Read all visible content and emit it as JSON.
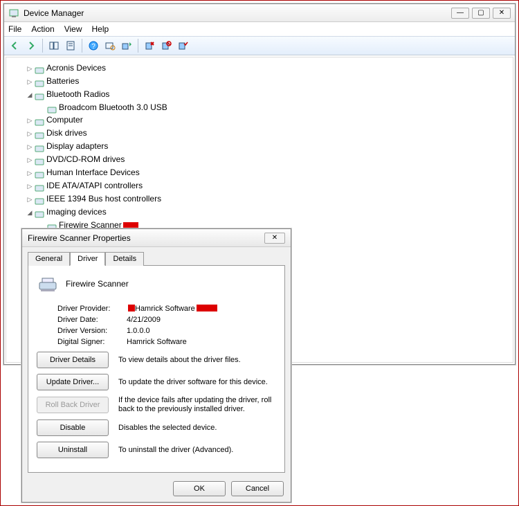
{
  "main": {
    "title": "Device Manager",
    "menu": [
      "File",
      "Action",
      "View",
      "Help"
    ],
    "tree": [
      {
        "label": "Acronis Devices",
        "expander": "▷"
      },
      {
        "label": "Batteries",
        "expander": "▷"
      },
      {
        "label": "Bluetooth Radios",
        "expander": "◢",
        "children": [
          {
            "label": "Broadcom Bluetooth 3.0 USB"
          }
        ]
      },
      {
        "label": "Computer",
        "expander": "▷"
      },
      {
        "label": "Disk drives",
        "expander": "▷"
      },
      {
        "label": "Display adapters",
        "expander": "▷"
      },
      {
        "label": "DVD/CD-ROM drives",
        "expander": "▷"
      },
      {
        "label": "Human Interface Devices",
        "expander": "▷"
      },
      {
        "label": "IDE ATA/ATAPI controllers",
        "expander": "▷"
      },
      {
        "label": "IEEE 1394 Bus host controllers",
        "expander": "▷"
      },
      {
        "label": "Imaging devices",
        "expander": "◢",
        "children": [
          {
            "label": "Firewire Scanner",
            "redact": true
          }
        ]
      }
    ]
  },
  "props": {
    "title": "Firewire Scanner Properties",
    "tabs": [
      "General",
      "Driver",
      "Details"
    ],
    "activeTab": "Driver",
    "deviceName": "Firewire Scanner",
    "info": {
      "providerLabel": "Driver Provider:",
      "provider": "Hamrick Software",
      "dateLabel": "Driver Date:",
      "date": "4/21/2009",
      "versionLabel": "Driver Version:",
      "version": "1.0.0.0",
      "signerLabel": "Digital Signer:",
      "signer": "Hamrick Software"
    },
    "actions": {
      "details": {
        "label": "Driver Details",
        "desc": "To view details about the driver files."
      },
      "update": {
        "label": "Update Driver...",
        "desc": "To update the driver software for this device."
      },
      "rollback": {
        "label": "Roll Back Driver",
        "desc": "If the device fails after updating the driver, roll back to the previously installed driver."
      },
      "disable": {
        "label": "Disable",
        "desc": "Disables the selected device."
      },
      "uninstall": {
        "label": "Uninstall",
        "desc": "To uninstall the driver (Advanced)."
      }
    },
    "ok": "OK",
    "cancel": "Cancel"
  }
}
